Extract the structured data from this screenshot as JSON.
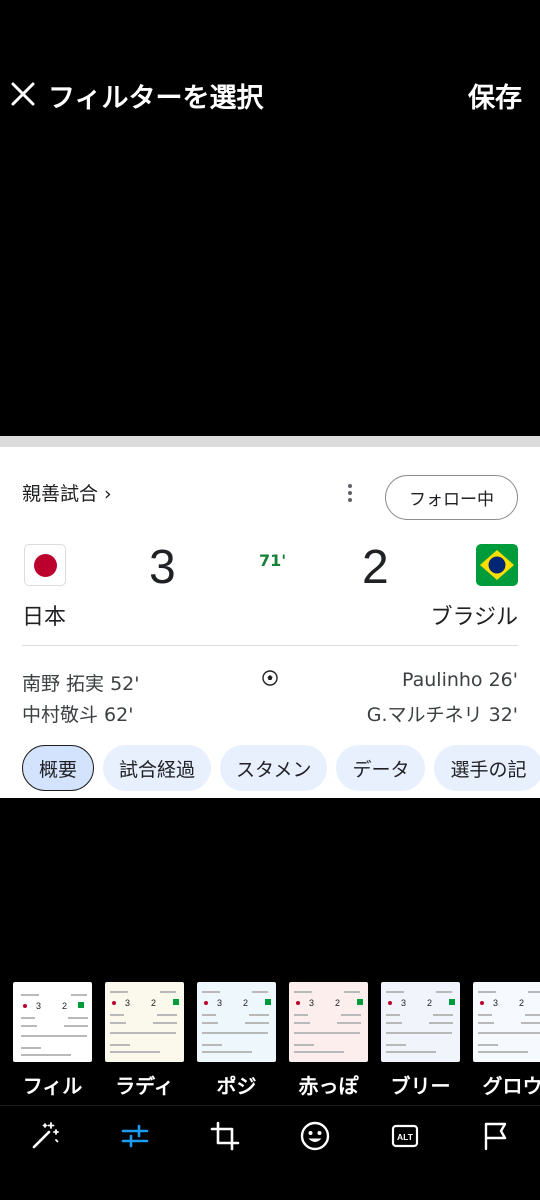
{
  "header": {
    "close_icon": "close-icon",
    "title": "フィルターを選択",
    "save_label": "保存"
  },
  "preview": {
    "breadcrumb": "親善試合 ›",
    "follow_label": "フォロー中",
    "home": {
      "name": "日本",
      "score": "3",
      "flag": "japan-flag"
    },
    "away": {
      "name": "ブラジル",
      "score": "2",
      "flag": "brazil-flag"
    },
    "minute": "71'",
    "home_scorers": [
      "南野 拓実 52'",
      "中村敬斗 62'"
    ],
    "away_scorers": [
      "Paulinho 26'",
      "G.マルチネリ 32'"
    ],
    "tabs": [
      "概要",
      "試合経過",
      "スタメン",
      "データ",
      "選手の記"
    ],
    "active_tab": "概要"
  },
  "filters": [
    {
      "label": "フィル",
      "tint": "#ffffff",
      "selected": true
    },
    {
      "label": "ラディ",
      "tint": "#fbf8ec",
      "selected": false
    },
    {
      "label": "ポジ",
      "tint": "#eef7fb",
      "selected": false
    },
    {
      "label": "赤っぽ",
      "tint": "#fdeeee",
      "selected": false
    },
    {
      "label": "ブリー",
      "tint": "#f1f5fb",
      "selected": false
    },
    {
      "label": "グロウ",
      "tint": "#f6f9fd",
      "selected": false
    }
  ],
  "toolbar": {
    "tools": [
      "magic-wand-icon",
      "adjust-icon",
      "crop-icon",
      "emoji-icon",
      "alt-text-icon",
      "flag-icon"
    ],
    "alt_label": "ALT",
    "active_color": "#1d9bf0"
  }
}
